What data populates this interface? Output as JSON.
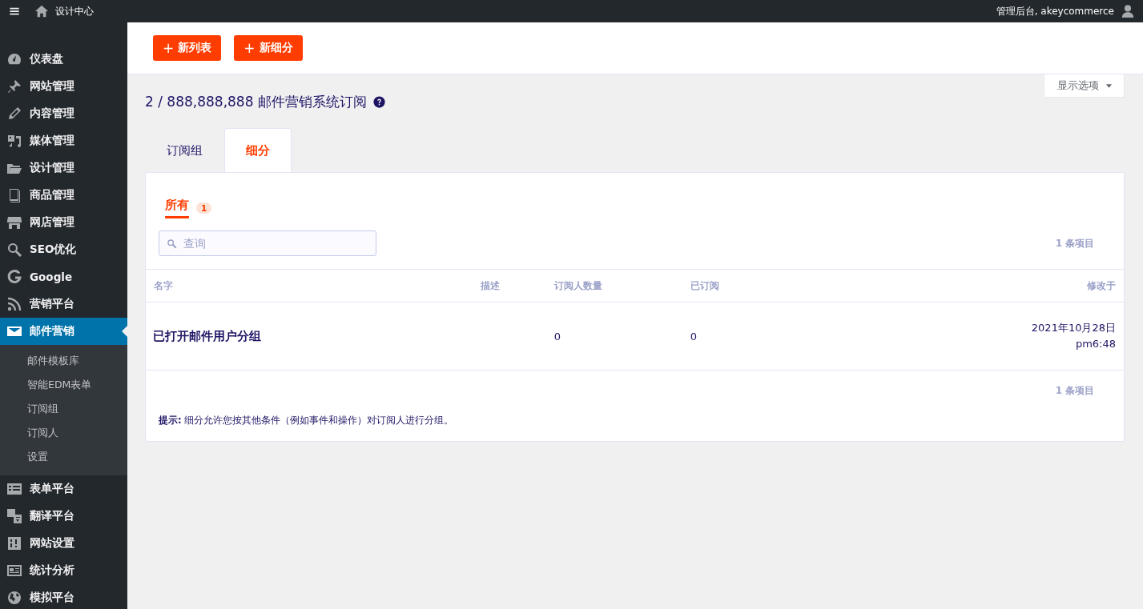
{
  "topbar": {
    "site_title": "设计中心",
    "account": "管理后台, akeycommerce"
  },
  "sidebar": {
    "items": [
      {
        "label": "仪表盘",
        "selected": false
      },
      {
        "label": "网站管理",
        "selected": false
      },
      {
        "label": "内容管理",
        "selected": false
      },
      {
        "label": "媒体管理",
        "selected": false
      },
      {
        "label": "设计管理",
        "selected": false
      },
      {
        "label": "商品管理",
        "selected": false
      },
      {
        "label": "网店管理",
        "selected": false
      },
      {
        "label": "SEO优化",
        "selected": false
      },
      {
        "label": "Google",
        "selected": false
      },
      {
        "label": "营销平台",
        "selected": false
      },
      {
        "label": "邮件营销",
        "selected": true,
        "children": [
          {
            "label": "邮件模板库"
          },
          {
            "label": "智能EDM表单"
          },
          {
            "label": "订阅组"
          },
          {
            "label": "订阅人"
          },
          {
            "label": "设置"
          }
        ]
      },
      {
        "label": "表单平台",
        "selected": false
      },
      {
        "label": "翻译平台",
        "selected": false
      },
      {
        "label": "网站设置",
        "selected": false
      },
      {
        "label": "统计分析",
        "selected": false
      },
      {
        "label": "模拟平台",
        "selected": false
      }
    ]
  },
  "header": {
    "buttons": [
      {
        "icon": "+",
        "label": "新列表"
      },
      {
        "icon": "+",
        "label": "新细分"
      }
    ]
  },
  "screen_options": "显示选项",
  "page_title": "2 / 888,888,888 邮件营销系统订阅",
  "tabs": [
    {
      "label": "订阅组",
      "selected": false
    },
    {
      "label": "细分",
      "selected": true
    }
  ],
  "filters": [
    {
      "label": "所有",
      "count": "1",
      "selected": true
    }
  ],
  "search": {
    "placeholder": "查询"
  },
  "item_count_top": "1 条项目",
  "table": {
    "columns": [
      "名字",
      "描述",
      "订阅人数量",
      "已订阅",
      "修改于"
    ],
    "rows": [
      {
        "name": "已打开邮件用户分组",
        "description": "",
        "subscribers": "0",
        "subscribed": "0",
        "modified": [
          "2021年10月28日",
          "pm6:48"
        ]
      }
    ]
  },
  "item_count_bottom": "1 条项目",
  "hint": "**提示:** 细分允许您按其他条件（例如事件和操作）对订阅人进行分组。"
}
